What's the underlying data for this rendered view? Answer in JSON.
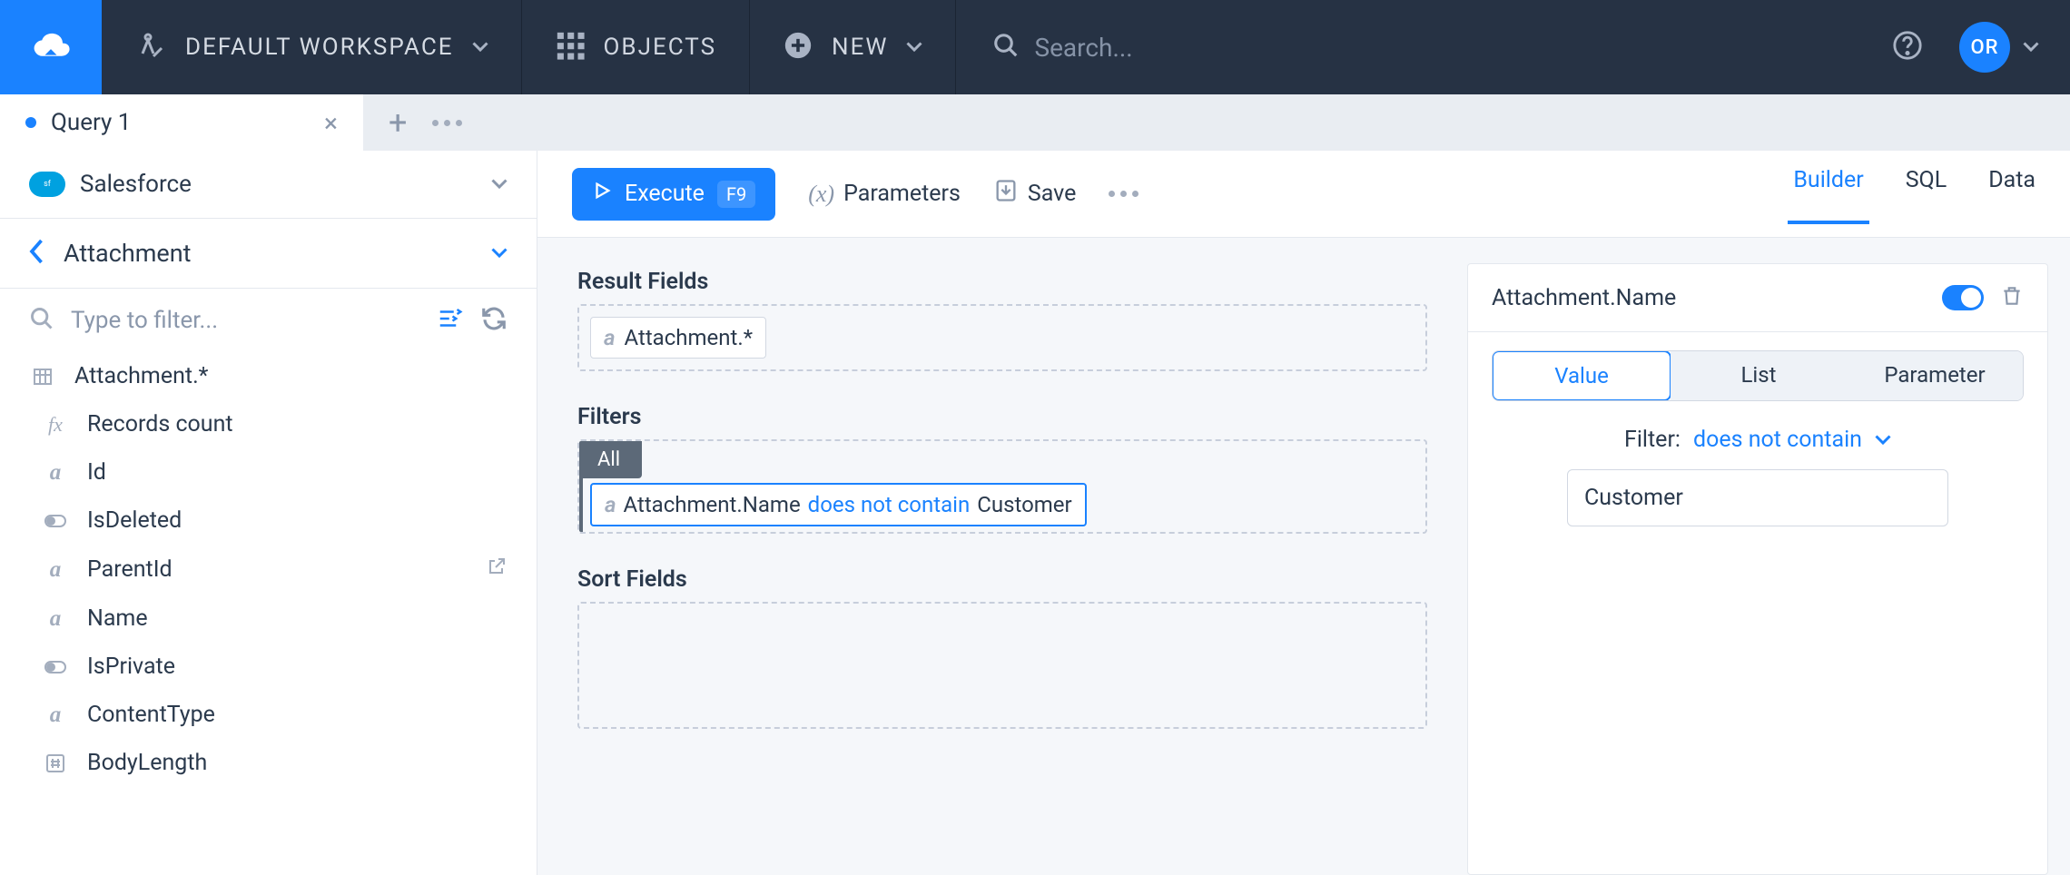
{
  "topbar": {
    "workspace_label": "DEFAULT WORKSPACE",
    "objects_label": "OBJECTS",
    "new_label": "NEW",
    "search_placeholder": "Search...",
    "avatar_initials": "OR"
  },
  "tabs": {
    "items": [
      {
        "title": "Query 1",
        "dirty": true
      }
    ]
  },
  "sidebar": {
    "connection": "Salesforce",
    "object": "Attachment",
    "filter_placeholder": "Type to filter...",
    "fields": [
      {
        "label": "Attachment.*",
        "icon": "table",
        "root": true
      },
      {
        "label": "Records count",
        "icon": "fx"
      },
      {
        "label": "Id",
        "icon": "a"
      },
      {
        "label": "IsDeleted",
        "icon": "bool"
      },
      {
        "label": "ParentId",
        "icon": "a",
        "ext": true
      },
      {
        "label": "Name",
        "icon": "a"
      },
      {
        "label": "IsPrivate",
        "icon": "bool"
      },
      {
        "label": "ContentType",
        "icon": "a"
      },
      {
        "label": "BodyLength",
        "icon": "hash"
      }
    ]
  },
  "toolbar": {
    "execute_label": "Execute",
    "execute_kbd": "F9",
    "parameters_label": "Parameters",
    "save_label": "Save",
    "view_tabs": [
      "Builder",
      "SQL",
      "Data"
    ],
    "active_view": "Builder"
  },
  "builder": {
    "result_fields_title": "Result Fields",
    "result_fields": [
      "Attachment.*"
    ],
    "filters_title": "Filters",
    "filters_group": "All",
    "filters": [
      {
        "field": "Attachment.Name",
        "op": "does not contain",
        "value": "Customer"
      }
    ],
    "sort_title": "Sort Fields"
  },
  "inspector": {
    "title": "Attachment.Name",
    "tabs": [
      "Value",
      "List",
      "Parameter"
    ],
    "active_tab": "Value",
    "filter_label": "Filter:",
    "operator": "does not contain",
    "value": "Customer"
  }
}
